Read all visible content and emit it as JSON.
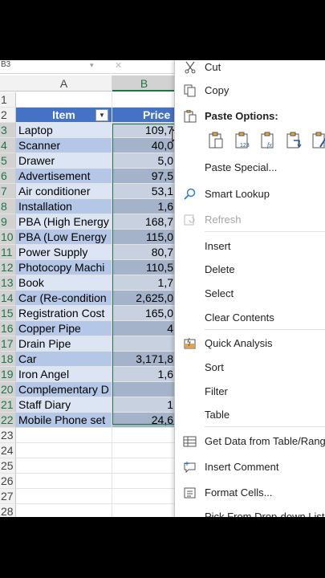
{
  "formula_bar": {
    "name_box": "B3"
  },
  "columns": [
    "A",
    "B"
  ],
  "header_row": {
    "num": "2",
    "item": "Item",
    "price": "Price"
  },
  "blank_row": {
    "num": "1"
  },
  "rows": [
    {
      "num": "3",
      "item": "Laptop",
      "price": "109,7"
    },
    {
      "num": "4",
      "item": "Scanner",
      "price": "40,0"
    },
    {
      "num": "5",
      "item": "Drawer",
      "price": "5,0"
    },
    {
      "num": "6",
      "item": "Advertisement",
      "price": "97,5"
    },
    {
      "num": "7",
      "item": "Air conditioner",
      "price": "53,1"
    },
    {
      "num": "8",
      "item": "Installation",
      "price": "1,6"
    },
    {
      "num": "9",
      "item": "PBA (High Energy",
      "price": "168,7"
    },
    {
      "num": "10",
      "item": "PBA (Low Energy",
      "price": "115,0"
    },
    {
      "num": "11",
      "item": "Power Supply",
      "price": "80,7"
    },
    {
      "num": "12",
      "item": "Photocopy Machi",
      "price": "110,5"
    },
    {
      "num": "13",
      "item": "Book",
      "price": "1,7"
    },
    {
      "num": "14",
      "item": "Car (Re-condition",
      "price": "2,625,0"
    },
    {
      "num": "15",
      "item": "Registration Cost",
      "price": "165,0"
    },
    {
      "num": "16",
      "item": "Copper Pipe",
      "price": "4"
    },
    {
      "num": "17",
      "item": "Drain Pipe",
      "price": ""
    },
    {
      "num": "18",
      "item": "Car",
      "price": "3,171,8"
    },
    {
      "num": "19",
      "item": "Iron Angel",
      "price": "1,6"
    },
    {
      "num": "20",
      "item": "Complementary D",
      "price": ""
    },
    {
      "num": "21",
      "item": "Staff Diary",
      "price": "1"
    },
    {
      "num": "22",
      "item": "Mobile Phone set",
      "price": "24,6"
    }
  ],
  "empty_rows": [
    "23",
    "24",
    "25",
    "26",
    "27",
    "28"
  ],
  "context_menu": {
    "cut": "Cut",
    "copy": "Copy",
    "paste_options": "Paste Options:",
    "paste_special": "Paste Special...",
    "smart_lookup": "Smart Lookup",
    "refresh": "Refresh",
    "insert": "Insert",
    "delete": "Delete",
    "select": "Select",
    "clear_contents": "Clear Contents",
    "quick_analysis": "Quick Analysis",
    "sort": "Sort",
    "filter": "Filter",
    "table": "Table",
    "get_data": "Get Data from Table/Range",
    "insert_comment": "Insert Comment",
    "format_cells": "Format Cells...",
    "pick_from_list": "Pick From Drop-down List..."
  },
  "colors": {
    "table_header": "#4472c4",
    "band_light": "#dbe5f3",
    "band_dark": "#b4c7e7",
    "selection": "#217346"
  }
}
